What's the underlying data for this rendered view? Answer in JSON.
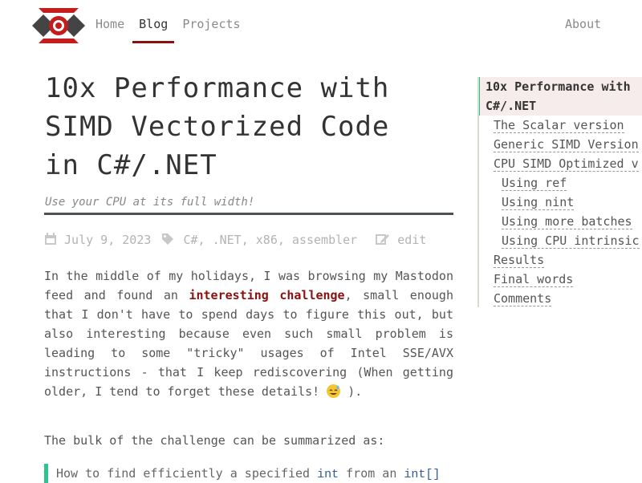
{
  "nav": {
    "items": [
      "Home",
      "Blog",
      "Projects"
    ],
    "active": "Blog",
    "about": "About"
  },
  "article": {
    "title_lines": [
      "10x Performance with",
      "SIMD Vectorized Code",
      "in C#/.NET"
    ],
    "subtitle": "Use your CPU at its full width!",
    "date": "July 9, 2023",
    "tags": "C#, .NET, x86, assembler",
    "edit_label": "edit",
    "para1_a": "In the middle of my holidays, I was browsing my Mastodon feed and found an ",
    "para1_link": "interesting challenge",
    "para1_b": ", small enough that I don't have to spend days to figure this out, but also interesting because even such small problem is leading to some \"tricky\" usages of Intel SSE/AVX instructions - that I keep rediscovering (When getting older, I tend to forget these details! ",
    "para1_c": " ).",
    "para2": "The bulk of the challenge can be summarized as:",
    "quote_a": "How to find efficiently a specified ",
    "quote_code1": "int",
    "quote_b": " from an ",
    "quote_code2": "int[]"
  },
  "toc": {
    "active_line1": "10x Performance with",
    "active_line2": "C#/.NET",
    "items": [
      {
        "label": "The Scalar version",
        "level": 1
      },
      {
        "label": "Generic SIMD Version",
        "level": 1
      },
      {
        "label": "CPU SIMD Optimized v",
        "level": 1
      },
      {
        "label": "Using ref",
        "level": 2
      },
      {
        "label": "Using nint",
        "level": 2
      },
      {
        "label": "Using more batches",
        "level": 2
      },
      {
        "label": "Using CPU intrinsic",
        "level": 2
      },
      {
        "label": "Results",
        "level": 1
      },
      {
        "label": "Final words",
        "level": 1
      },
      {
        "label": "Comments",
        "level": 1
      }
    ]
  },
  "colors": {
    "accent": "#8b1010",
    "quote_bar": "#2dc48a",
    "divider": "#4a5157"
  }
}
